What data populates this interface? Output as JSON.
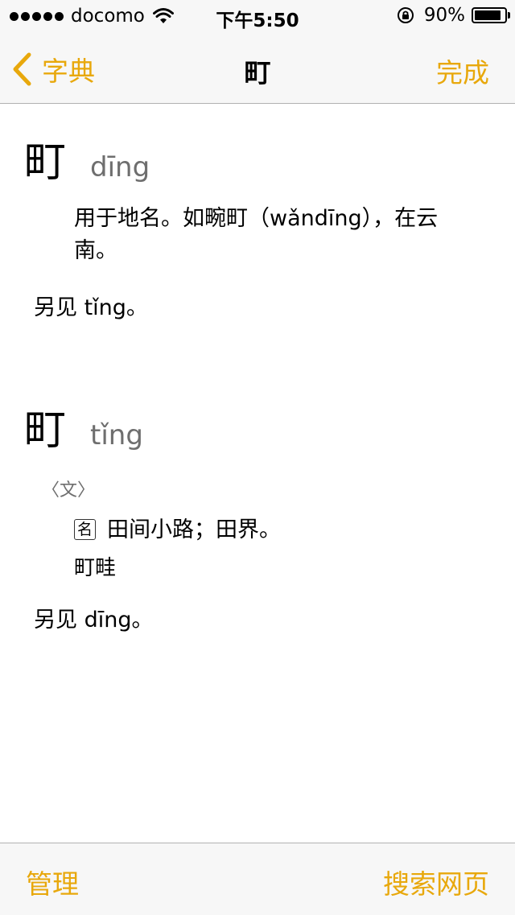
{
  "status_bar": {
    "carrier": "docomo",
    "time": "下午5:50",
    "battery_percent": "90%",
    "battery_level": 0.9,
    "signal_bars": 5
  },
  "nav": {
    "back_label": "字典",
    "title": "町",
    "done_label": "完成"
  },
  "entries": [
    {
      "char": "町",
      "pinyin": "dīng",
      "definition": "用于地名。如畹町（wǎndīng），在云南。",
      "see_also": "另见 tǐng。"
    },
    {
      "char": "町",
      "pinyin": "tǐng",
      "register": "〈文〉",
      "pos": "名",
      "definition": "田间小路；田界。",
      "example": "町畦",
      "see_also": "另见 dīng。"
    }
  ],
  "toolbar": {
    "manage_label": "管理",
    "search_web_label": "搜索网页"
  },
  "colors": {
    "accent": "#e8a80c",
    "bar_background": "#f7f7f7",
    "secondary_text": "#6e6e6e"
  }
}
